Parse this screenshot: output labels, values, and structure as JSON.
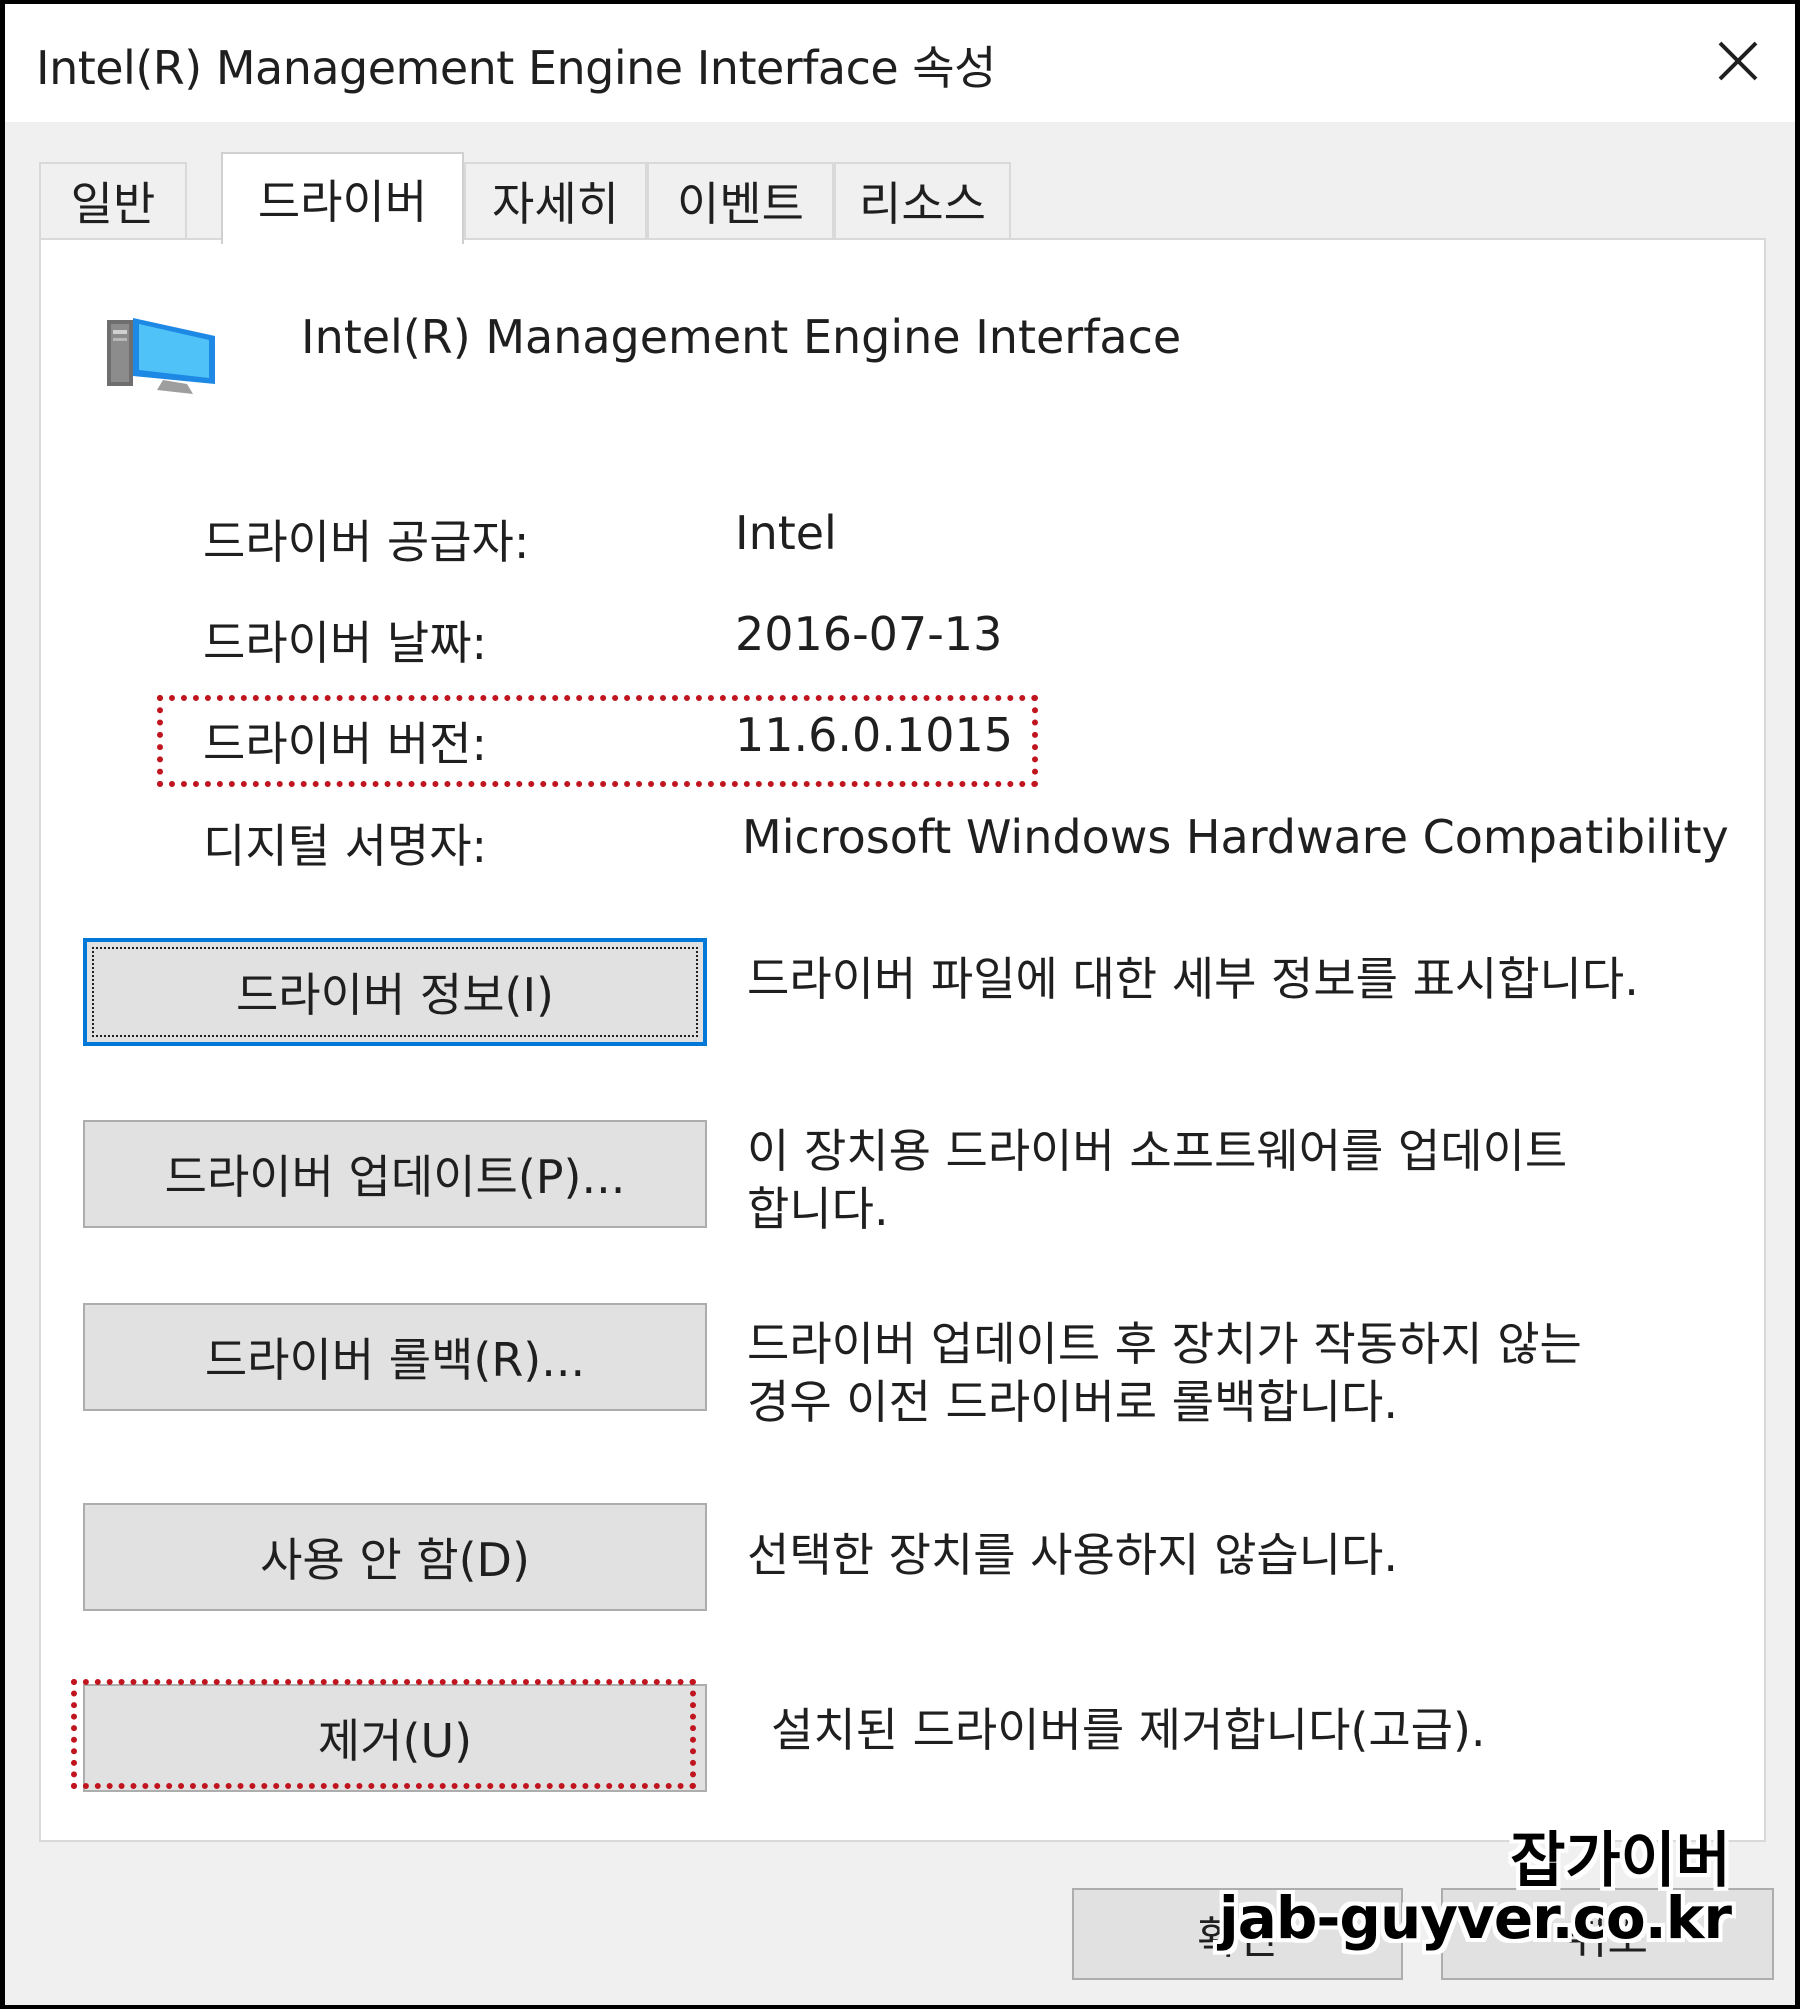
{
  "window": {
    "title": "Intel(R) Management Engine Interface  속성"
  },
  "tabs": [
    {
      "label": "일반"
    },
    {
      "label": "드라이버"
    },
    {
      "label": "자세히"
    },
    {
      "label": "이벤트"
    },
    {
      "label": "리소스"
    }
  ],
  "active_tab": "드라이버",
  "device": {
    "name": "Intel(R) Management Engine Interface",
    "icon": "computer-icon"
  },
  "properties": [
    {
      "label": "드라이버 공급자:",
      "value": "Intel"
    },
    {
      "label": "드라이버 날짜:",
      "value": "2016-07-13"
    },
    {
      "label": "드라이버 버전:",
      "value": "11.6.0.1015"
    },
    {
      "label": "디지털 서명자:",
      "value": "Microsoft Windows Hardware Compatibility"
    }
  ],
  "actions": [
    {
      "button": "드라이버 정보(I)",
      "desc": [
        "드라이버 파일에 대한 세부 정보를 표시합니다."
      ]
    },
    {
      "button": "드라이버 업데이트(P)...",
      "desc": [
        "이 장치용 드라이버 소프트웨어를 업데이트",
        "합니다."
      ]
    },
    {
      "button": "드라이버 롤백(R)...",
      "desc": [
        "드라이버 업데이트 후 장치가 작동하지 않는",
        "경우 이전 드라이버로 롤백합니다."
      ]
    },
    {
      "button": "사용 안 함(D)",
      "desc": [
        "선택한 장치를 사용하지 않습니다."
      ]
    },
    {
      "button": "제거(U)",
      "desc": [
        "설치된 드라이버를 제거합니다(고급)."
      ]
    }
  ],
  "footer": {
    "ok": "확인",
    "cancel": "취소"
  },
  "watermark": {
    "name": "잡가이버",
    "url": "jab-guyver.co.kr"
  },
  "colors": {
    "highlight": "#c0141e",
    "focus": "#0078d7"
  }
}
